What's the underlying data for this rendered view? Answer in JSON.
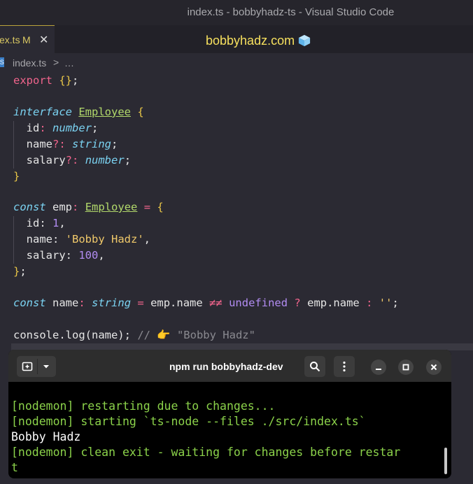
{
  "window": {
    "title": "index.ts - bobbyhadz-ts - Visual Studio Code"
  },
  "tab": {
    "name": "ex.ts",
    "modified": "M",
    "close": "✕"
  },
  "brand": {
    "text": "bobbyhadz.com"
  },
  "breadcrumb": {
    "icon_text": "TS",
    "file": "index.ts",
    "separator": ">",
    "more": "…"
  },
  "code": {
    "l1": [
      "export",
      " {}",
      ";"
    ],
    "l3": [
      "interface",
      "Employee",
      "{"
    ],
    "l4": [
      "id",
      ":",
      "number",
      ";"
    ],
    "l5": [
      "name",
      "?:",
      "string",
      ";"
    ],
    "l6": [
      "salary",
      "?:",
      "number",
      ";"
    ],
    "l7": "}",
    "l9": [
      "const",
      "emp",
      ":",
      "Employee",
      "=",
      "{"
    ],
    "l10": [
      "id: ",
      "1",
      ","
    ],
    "l11": [
      "name: ",
      "'Bobby Hadz'",
      ","
    ],
    "l12": [
      "salary: ",
      "100",
      ","
    ],
    "l13": [
      "}",
      ";"
    ],
    "l15": [
      "const",
      "name",
      ":",
      "string",
      "=",
      "emp.name",
      "≠≠",
      "undefined",
      "?",
      "emp.name",
      ":",
      "''",
      ";"
    ],
    "l17": [
      "console.log(name); ",
      "// ",
      "👉",
      " \"Bobby Hadz\""
    ]
  },
  "terminal": {
    "title": "npm run bobbyhadz-dev",
    "lines": [
      "[nodemon] restarting due to changes...",
      "[nodemon] starting `ts-node --files ./src/index.ts`",
      "Bobby Hadz",
      "[nodemon] clean exit - waiting for changes before restar",
      "t"
    ]
  }
}
